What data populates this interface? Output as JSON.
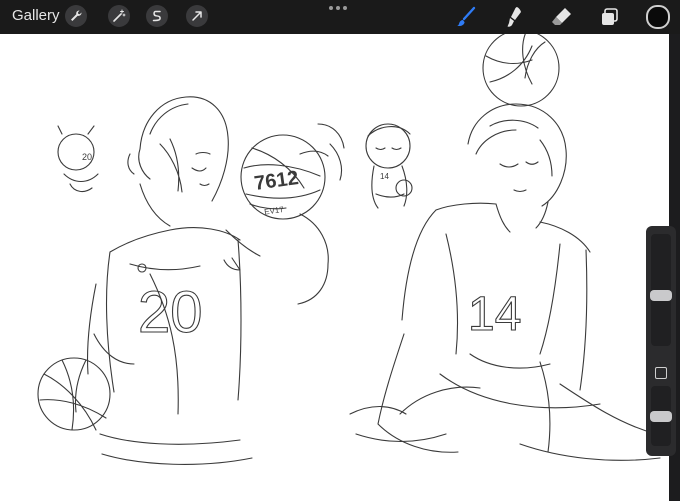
{
  "toolbar": {
    "gallery_label": "Gallery",
    "left_tools": [
      {
        "name": "actions",
        "icon": "wrench-icon"
      },
      {
        "name": "adjustments",
        "icon": "magic-wand-icon"
      },
      {
        "name": "selection",
        "icon": "selection-s-icon"
      },
      {
        "name": "transform",
        "icon": "arrow-cursor-icon"
      }
    ],
    "right_tools": [
      {
        "name": "brush",
        "icon": "brush-icon",
        "active": true
      },
      {
        "name": "smudge",
        "icon": "smudge-icon"
      },
      {
        "name": "eraser",
        "icon": "eraser-icon"
      },
      {
        "name": "layers",
        "icon": "layers-icon"
      }
    ],
    "color": "#0a0a0a",
    "active_color": "#2f7cf6"
  },
  "sidebar": {
    "brush_size": 0.45,
    "brush_opacity": 0.5
  },
  "canvas": {
    "ball_text": "7612",
    "ball_sub": "EV17",
    "jersey_left": "20",
    "jersey_right": "14",
    "chibi_left_number": "20",
    "chibi_right_number": "14"
  }
}
